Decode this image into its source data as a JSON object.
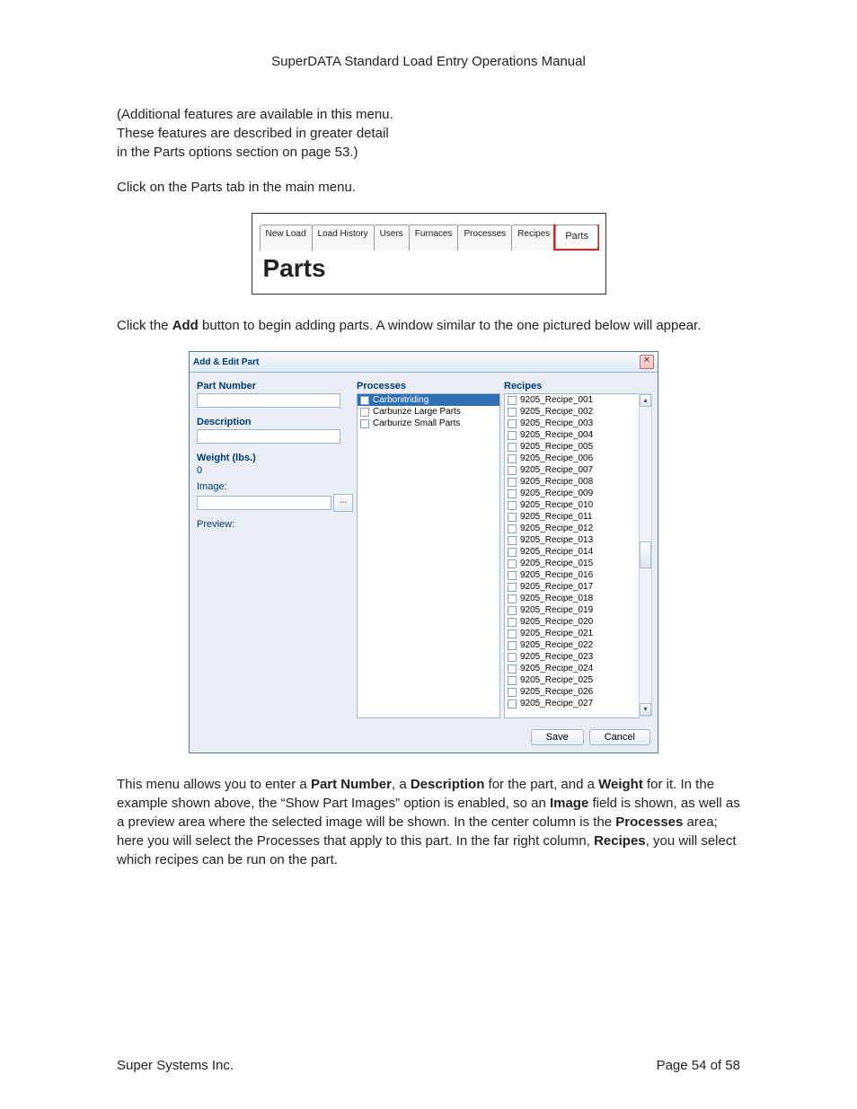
{
  "doc_title": "SuperDATA Standard Load Entry Operations Manual",
  "intro_para": {
    "l1": "(Additional features are available in this menu.",
    "l2": "These features are described in greater detail",
    "l3": "in the Parts options section on page 53.)"
  },
  "instr1": "Click on the Parts tab in the main menu.",
  "tabs": {
    "items": [
      "New Load",
      "Load History",
      "Users",
      "Furnaces",
      "Processes",
      "Recipes"
    ],
    "active": "Parts",
    "heading": "Parts"
  },
  "instr2": {
    "pre": "Click the ",
    "bold": "Add",
    "post": " button to begin adding parts. A window similar to the one pictured below will appear."
  },
  "dialog": {
    "title": "Add & Edit Part",
    "labels": {
      "part_number": "Part Number",
      "description": "Description",
      "weight": "Weight (lbs.)",
      "image": "Image:",
      "preview": "Preview:",
      "processes": "Processes",
      "recipes": "Recipes"
    },
    "values": {
      "part_number": "",
      "description": "",
      "weight": "0",
      "image": ""
    },
    "browse_btn": "...",
    "processes": [
      {
        "label": "Carbonitriding",
        "selected": true
      },
      {
        "label": "Carburize Large Parts",
        "selected": false
      },
      {
        "label": "Carburize Small Parts",
        "selected": false
      }
    ],
    "recipes": [
      "9205_Recipe_001",
      "9205_Recipe_002",
      "9205_Recipe_003",
      "9205_Recipe_004",
      "9205_Recipe_005",
      "9205_Recipe_006",
      "9205_Recipe_007",
      "9205_Recipe_008",
      "9205_Recipe_009",
      "9205_Recipe_010",
      "9205_Recipe_011",
      "9205_Recipe_012",
      "9205_Recipe_013",
      "9205_Recipe_014",
      "9205_Recipe_015",
      "9205_Recipe_016",
      "9205_Recipe_017",
      "9205_Recipe_018",
      "9205_Recipe_019",
      "9205_Recipe_020",
      "9205_Recipe_021",
      "9205_Recipe_022",
      "9205_Recipe_023",
      "9205_Recipe_024",
      "9205_Recipe_025",
      "9205_Recipe_026",
      "9205_Recipe_027"
    ],
    "save": "Save",
    "cancel": "Cancel"
  },
  "explain": {
    "t1": "This menu allows you to enter a ",
    "b1": "Part Number",
    "t2": ", a ",
    "b2": "Description",
    "t3": " for the part, and a ",
    "b3": "Weight",
    "t4": " for it. In the example shown above, the “Show Part Images” option is enabled, so an ",
    "b4": "Image",
    "t5": " field is shown, as well as a preview area where the selected image will be shown. In the center column is the ",
    "b5": "Processes",
    "t6": " area; here you will select the Processes that apply to this part. In the far right column, ",
    "b6": "Recipes",
    "t7": ", you will select which recipes can be run on the part."
  },
  "footer": {
    "left": "Super Systems Inc.",
    "right": "Page 54 of 58"
  }
}
